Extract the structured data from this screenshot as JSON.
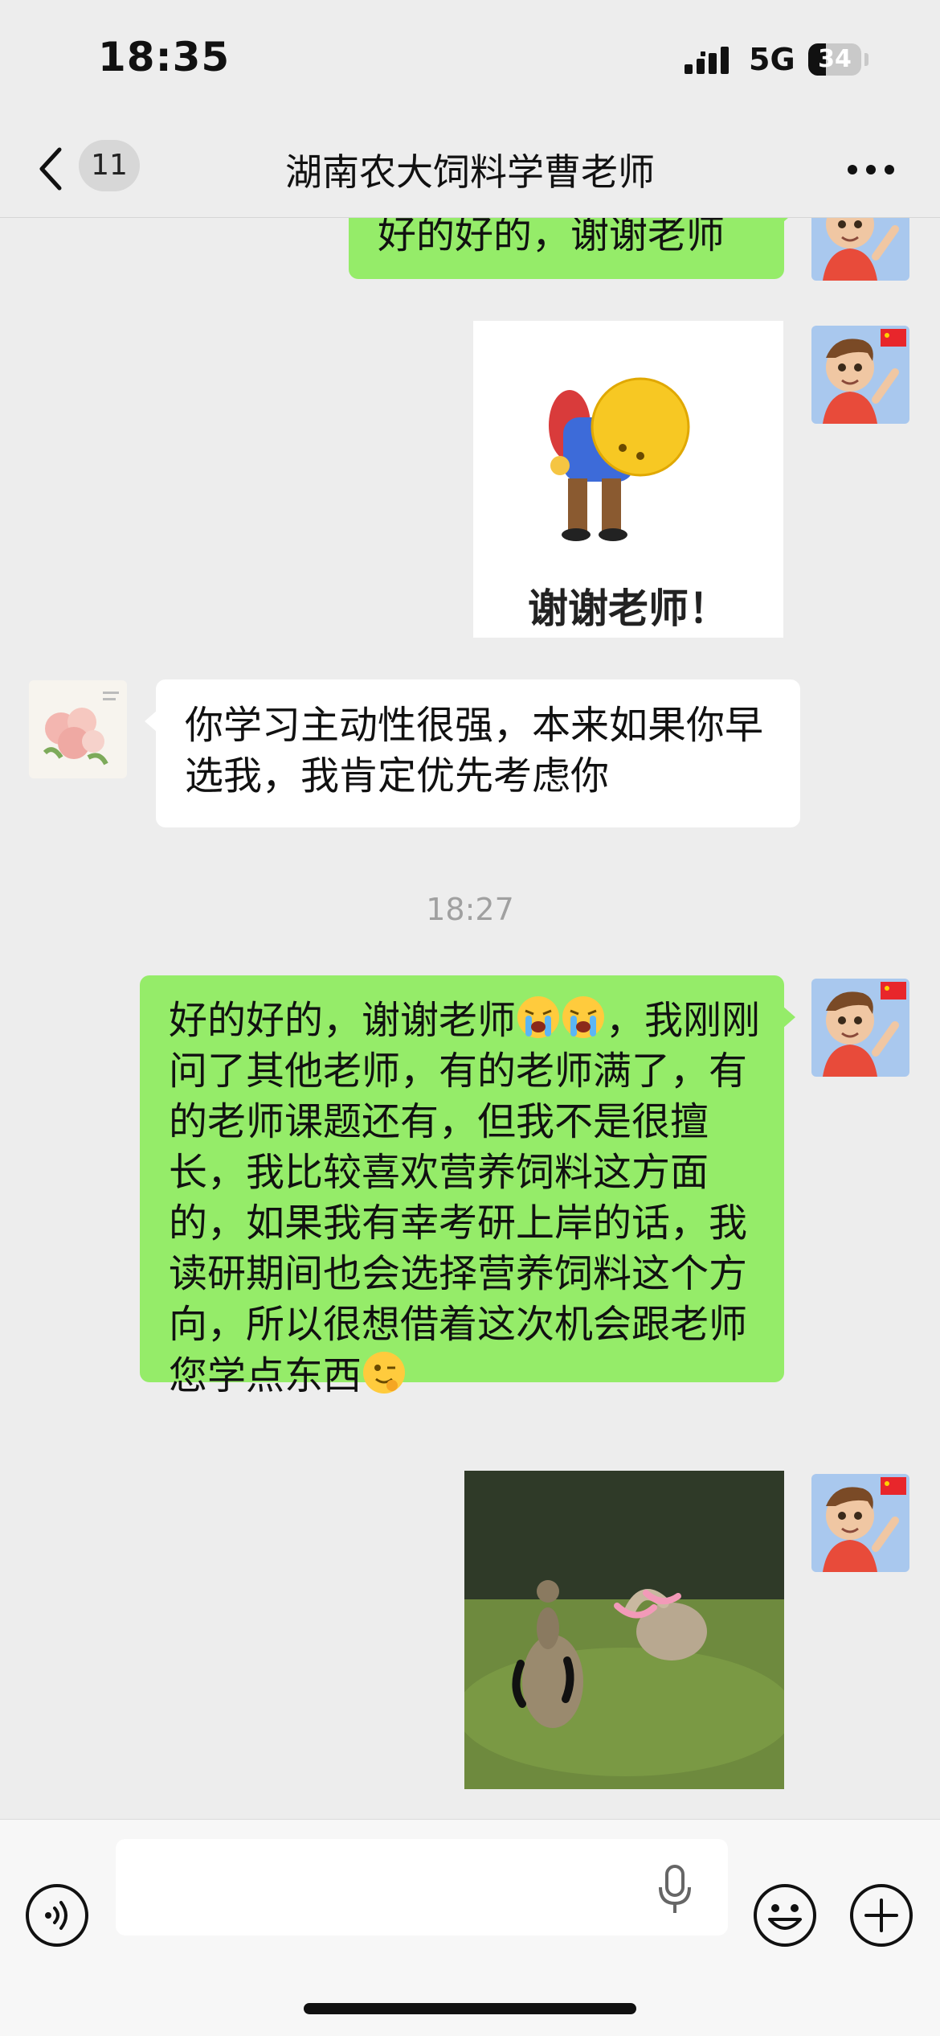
{
  "status_bar": {
    "time": "18:35",
    "network": "5G",
    "battery": "34",
    "battery_level": 0.34
  },
  "nav": {
    "back_icon": "chevron-left-icon",
    "unread_count": "11",
    "title": "湖南农大饲料学曹老师",
    "more_icon": "more-dots-icon"
  },
  "messages": [
    {
      "sender": "me",
      "type": "text",
      "text": "好的好的，谢谢老师"
    },
    {
      "sender": "me",
      "type": "sticker",
      "caption": "谢谢老师！"
    },
    {
      "sender": "teacher",
      "type": "text",
      "text": "你学习主动性很强，本来如果你早选我，我肯定优先考虑你"
    },
    {
      "type": "timestamp",
      "text": "18:27"
    },
    {
      "sender": "me",
      "type": "text",
      "text_part1": "好的好的，谢谢老师",
      "text_part2": "，我刚刚问了其他老师，有的老师满了，有的老师课题还有，但我不是很擅长，我比较喜欢营养饲料这方面的，如果我有幸考研上岸的话，我读研期间也会选择营养饲料这个方向，所以很想借着这次机会跟老师您学点东西",
      "emojis": [
        "crying-emoji",
        "crying-emoji",
        "wink-emoji"
      ]
    },
    {
      "sender": "me",
      "type": "image",
      "image": "ducks-photo"
    }
  ],
  "input_bar": {
    "voice_icon": "voice-icon",
    "input_value": "",
    "mic_icon": "mic-icon",
    "emoji_icon": "smile-icon",
    "plus_icon": "plus-icon"
  },
  "colors": {
    "background": "#EDEDED",
    "outgoing_bubble": "#95EC69",
    "incoming_bubble": "#FFFFFF",
    "timestamp": "#A0A0A0"
  }
}
